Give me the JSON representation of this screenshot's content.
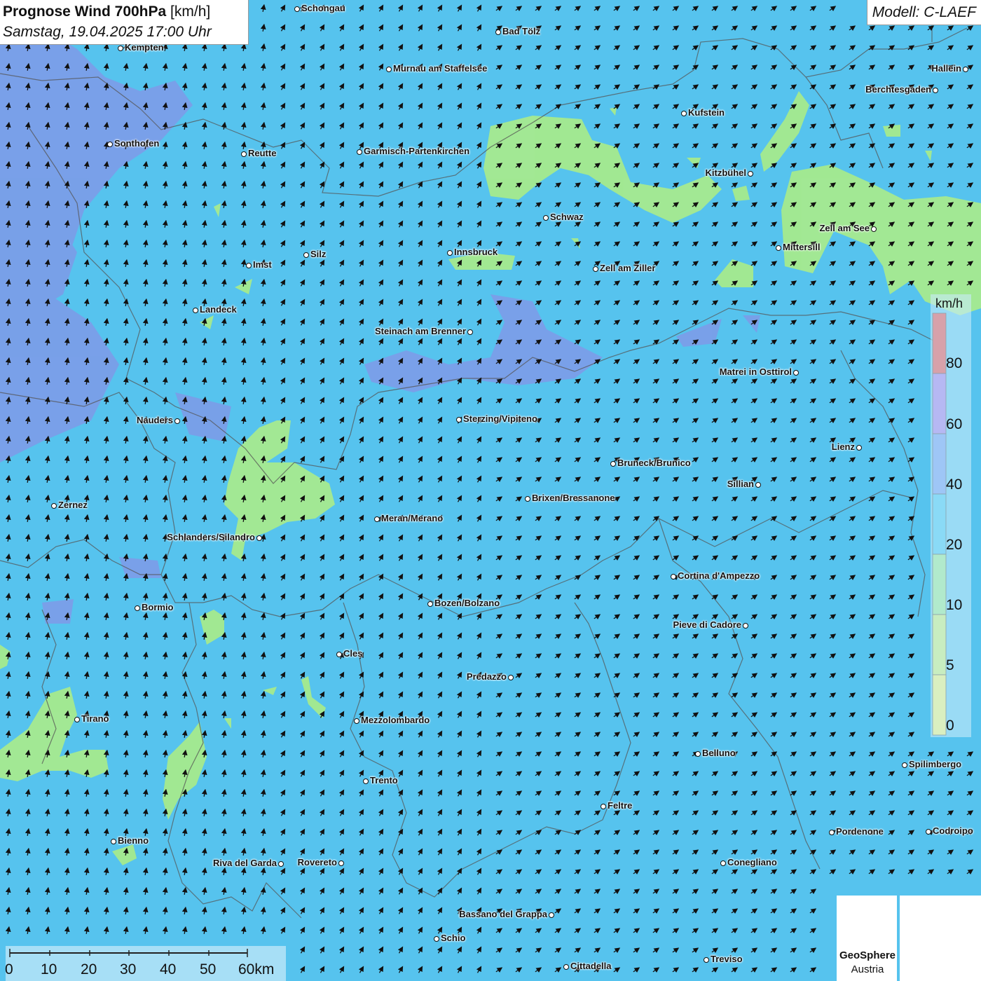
{
  "header": {
    "title_main": "Prognose Wind 700hPa",
    "title_unit": "[km/h]",
    "datetime": "Samstag, 19.04.2025 17:00 Uhr",
    "model": "Modell: C-LAEF"
  },
  "legend": {
    "unit": "km/h",
    "labels": [
      "80",
      "60",
      "40",
      "20",
      "10",
      "5",
      "0"
    ],
    "colors": [
      "#ee3333",
      "#9b6be8",
      "#5f8ff0",
      "#2fc0f0",
      "#8ee887",
      "#c9f06a",
      "#f6f66a"
    ]
  },
  "scale_bar": {
    "labels": [
      "0",
      "10",
      "20",
      "30",
      "40",
      "50",
      "60km"
    ]
  },
  "branding": {
    "name": "GeoSphere",
    "country": "Austria"
  },
  "colors": {
    "background": "#56c3ee",
    "wind_light": "#a6ea8e",
    "wind_strong": "#7f9ae8"
  },
  "cities": [
    {
      "name": "Schongau"
    },
    {
      "name": "Bad Tölz"
    },
    {
      "name": "Kempten"
    },
    {
      "name": "Murnau am Staffelsee"
    },
    {
      "name": "Hallein"
    },
    {
      "name": "Berchtesgaden"
    },
    {
      "name": "Kufstein"
    },
    {
      "name": "Sonthofen"
    },
    {
      "name": "Reutte"
    },
    {
      "name": "Garmisch-Partenkirchen"
    },
    {
      "name": "Kitzbühel"
    },
    {
      "name": "Schwaz"
    },
    {
      "name": "Zell am See"
    },
    {
      "name": "Mittersill"
    },
    {
      "name": "Innsbruck"
    },
    {
      "name": "Silz"
    },
    {
      "name": "Imst"
    },
    {
      "name": "Zell am Ziller"
    },
    {
      "name": "Landeck"
    },
    {
      "name": "Steinach am Brenner"
    },
    {
      "name": "Matrei in Osttirol"
    },
    {
      "name": "Nauders"
    },
    {
      "name": "Sterzing/Vipiteno"
    },
    {
      "name": "Lienz"
    },
    {
      "name": "Bruneck/Brunico"
    },
    {
      "name": "Sillian"
    },
    {
      "name": "Brixen/Bressanone"
    },
    {
      "name": "Zernez"
    },
    {
      "name": "Meran/Merano"
    },
    {
      "name": "Schlanders/Silandro"
    },
    {
      "name": "Cortina d'Ampezzo"
    },
    {
      "name": "Bozen/Bolzano"
    },
    {
      "name": "Bormio"
    },
    {
      "name": "Pieve di Cadore"
    },
    {
      "name": "Cles"
    },
    {
      "name": "Predazzo"
    },
    {
      "name": "Tirano"
    },
    {
      "name": "Mezzolombardo"
    },
    {
      "name": "Belluno"
    },
    {
      "name": "Spilimbergo"
    },
    {
      "name": "Trento"
    },
    {
      "name": "Feltre"
    },
    {
      "name": "Pordenone"
    },
    {
      "name": "Codroipo"
    },
    {
      "name": "Bienno"
    },
    {
      "name": "Riva del Garda"
    },
    {
      "name": "Rovereto"
    },
    {
      "name": "Conegliano"
    },
    {
      "name": "Bassano del Grappa"
    },
    {
      "name": "Schio"
    },
    {
      "name": "Treviso"
    },
    {
      "name": "Cittadella"
    }
  ]
}
